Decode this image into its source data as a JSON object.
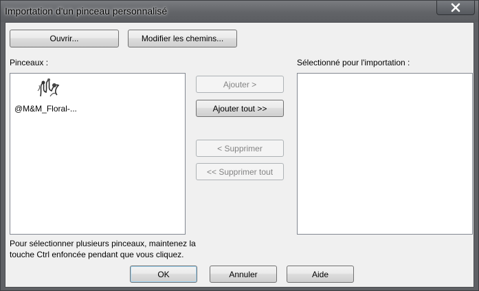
{
  "window": {
    "title": "Importation d'un pinceau personnalisé",
    "close_icon": "close-icon"
  },
  "toolbar": {
    "open_label": "Ouvrir...",
    "edit_paths_label": "Modifier les chemins..."
  },
  "brushes": {
    "label": "Pinceaux :",
    "items": [
      {
        "name": "@M&M_Floral-...",
        "thumbnail_icon": "floral-brush-thumbnail"
      }
    ]
  },
  "actions": {
    "add_label": "Ajouter >",
    "add_all_label": "Ajouter tout >>",
    "remove_label": "< Supprimer",
    "remove_all_label": "<< Supprimer tout"
  },
  "selected": {
    "label": "Sélectionné pour l'importation :",
    "items": []
  },
  "hint": {
    "line1": "Pour sélectionner plusieurs pinceaux, maintenez la",
    "line2": "touche Ctrl enfoncée pendant que vous cliquez."
  },
  "footer": {
    "ok_label": "OK",
    "cancel_label": "Annuler",
    "help_label": "Aide"
  },
  "colors": {
    "dialog_background": "#f0f0f0",
    "disabled_text": "#838383"
  }
}
